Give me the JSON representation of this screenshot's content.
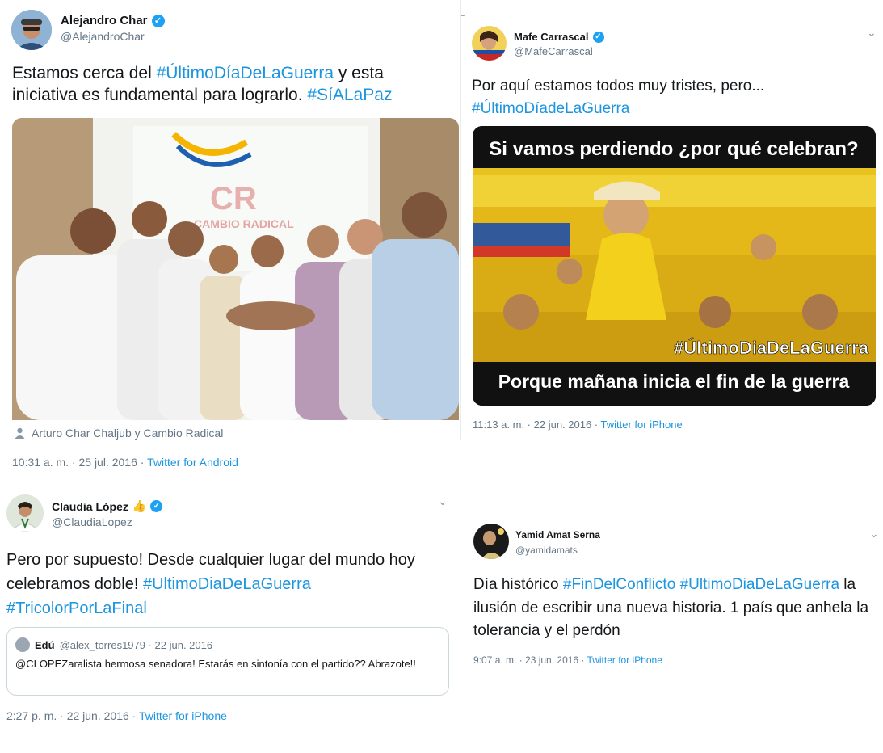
{
  "tweets": {
    "char": {
      "name": "Alejandro Char",
      "handle": "@AlejandroChar",
      "text_plain_1": "Estamos cerca del ",
      "hashtag_1": "#ÚltimoDíaDeLaGuerra",
      "text_plain_2": " y esta iniciativa es fundamental para lograrlo. ",
      "hashtag_2": "#SíALaPaz",
      "photo_sign": "CAMBIO RADICAL",
      "photo_sign_letters": "CR",
      "tagged": "Arturo Char Chaljub y Cambio Radical",
      "time": "10:31 a. m. · 25 jul. 2016 · ",
      "source": "Twitter for Android"
    },
    "mafe": {
      "name": "Mafe Carrascal",
      "handle": "@MafeCarrascal",
      "text_plain_1": "Por aquí estamos todos muy tristes, pero...",
      "hashtag_1": "#ÚltimoDíadeLaGuerra",
      "meme_top": "Si vamos perdiendo ¿por qué celebran?",
      "meme_hashtag": "#ÚltimoDiaDeLaGuerra",
      "meme_bottom": "Porque mañana inicia el fin de la guerra",
      "time": "11:13 a. m. · 22 jun. 2016 · ",
      "source": "Twitter for iPhone"
    },
    "claudia": {
      "name": "Claudia López",
      "emoji": "👍",
      "handle": "@ClaudiaLopez",
      "text_plain_1": "Pero por supuesto! Desde cualquier lugar del mundo hoy celebramos doble! ",
      "hashtag_1": "#UltimoDiaDeLaGuerra",
      "hashtag_2": "#TricolorPorLaFinal",
      "quote_name": "Edú",
      "quote_meta": "@alex_torres1979 · 22 jun. 2016",
      "quote_text": "@CLOPEZaralista hermosa senadora! Estarás en sintonía con el partido?? Abrazote!!",
      "time": "2:27 p. m. · 22 jun. 2016 · ",
      "source": "Twitter for iPhone"
    },
    "yamid": {
      "name": "Yamid Amat Serna",
      "handle": "@yamidamats",
      "text_plain_1": "Día histórico ",
      "hashtag_1": "#FinDelConflicto",
      "hashtag_2": "#UltimoDiaDeLaGuerra",
      "text_plain_2": " la ilusión de escribir una nueva historia. 1 país que anhela la tolerancia y el perdón",
      "time": "9:07 a. m. · 23 jun. 2016 · ",
      "source": "Twitter for iPhone"
    }
  },
  "icons": {
    "verified": "✓",
    "chevron": "⌄",
    "person": "person-icon"
  },
  "colors": {
    "link": "#1b95e0",
    "muted": "#657786",
    "verified": "#1da1f2"
  }
}
